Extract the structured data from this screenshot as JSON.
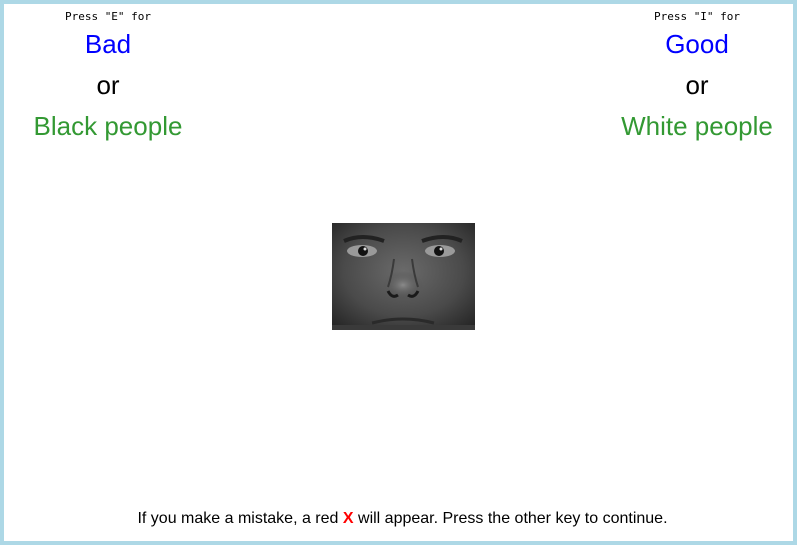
{
  "left": {
    "press": "Press \"E\" for",
    "attribute": "Bad",
    "or": "or",
    "category": "Black people"
  },
  "right": {
    "press": "Press \"I\" for",
    "attribute": "Good",
    "or": "or",
    "category": "White people"
  },
  "stimulus": {
    "kind": "face-photo-grayscale"
  },
  "footer": {
    "before": "If you make a mistake, a red",
    "mark": "X",
    "after": "will appear. Press the other key to continue."
  },
  "colors": {
    "border": "#add8e6",
    "attribute": "#0000ff",
    "category": "#339933",
    "error_mark": "#ff0000"
  }
}
